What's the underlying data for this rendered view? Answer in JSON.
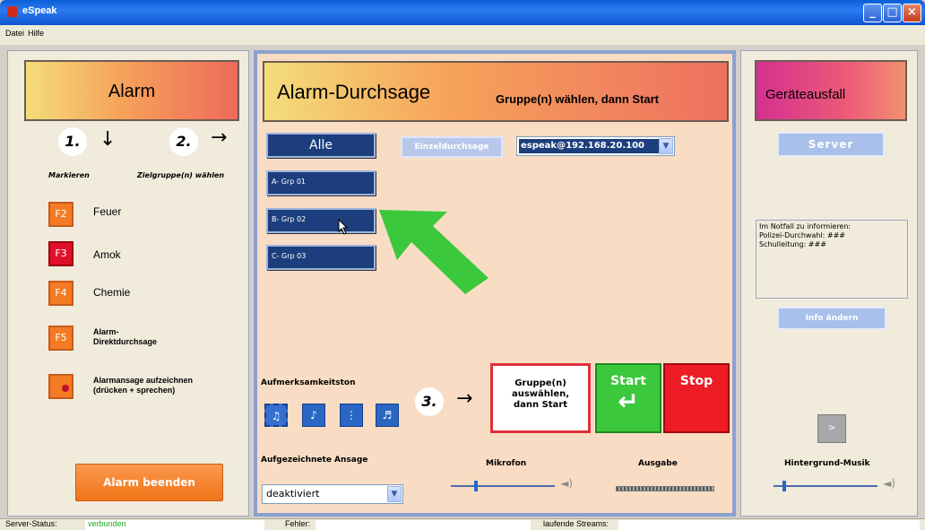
{
  "window": {
    "title": "eSpeak"
  },
  "menu": [
    "Datei",
    "Hilfe"
  ],
  "left": {
    "header": "Alarm",
    "step1": "1.",
    "step2": "2.",
    "label_markieren": "Markieren",
    "label_ziel": "Zielgruppe(n) wählen",
    "items": [
      {
        "key": "F2",
        "label": "Feuer"
      },
      {
        "key": "F3",
        "label": "Amok"
      },
      {
        "key": "F4",
        "label": "Chemie"
      },
      {
        "key": "F5",
        "label_line1": "Alarm-",
        "label_line2": "Direktdurchsage"
      }
    ],
    "record_line1": "Alarmansage aufzeichnen",
    "record_line2": "(drücken + sprechen)",
    "end_button": "Alarm beenden"
  },
  "middle": {
    "header_title": "Alarm-Durchsage",
    "header_sub": "Gruppe(n) wählen, dann Start",
    "alle": "Alle",
    "groups": [
      "A- Grp 01",
      "B- Grp 02",
      "C- Grp 03"
    ],
    "einzel": "Einzeldurchsage",
    "server_combo": "espeak@192.168.20.100",
    "aufmerksam_label": "Aufmerksamkeitston",
    "step3": "3.",
    "gruppe_box": [
      "Gruppe(n)",
      "auswählen,",
      "dann Start"
    ],
    "start": "Start",
    "stop": "Stop",
    "aufgezeichnet_label": "Aufgezeichnete Ansage",
    "select_value": "deaktiviert",
    "mikrofon": "Mikrofon",
    "ausgabe": "Ausgabe"
  },
  "right": {
    "header": "Geräteausfall",
    "server": "Server",
    "info_lines": [
      "Im Notfall zu informieren:",
      "Polizei-Durchwahl: ###",
      "Schulleitung: ###"
    ],
    "info_button": "Info ändern",
    "play": ">",
    "hintergrund": "Hintergrund-Musik"
  },
  "status": {
    "server_label": "Server-Status:",
    "server_value": "verbunden",
    "fehler_label": "Fehler:",
    "streams_label": "laufende Streams:"
  },
  "colors": {
    "accent_navy": "#1c3e7c",
    "start_green": "#3cc83c",
    "stop_red": "#ee1c24",
    "alarm_orange": "#f47b24",
    "status_ok": "#22aa22"
  }
}
